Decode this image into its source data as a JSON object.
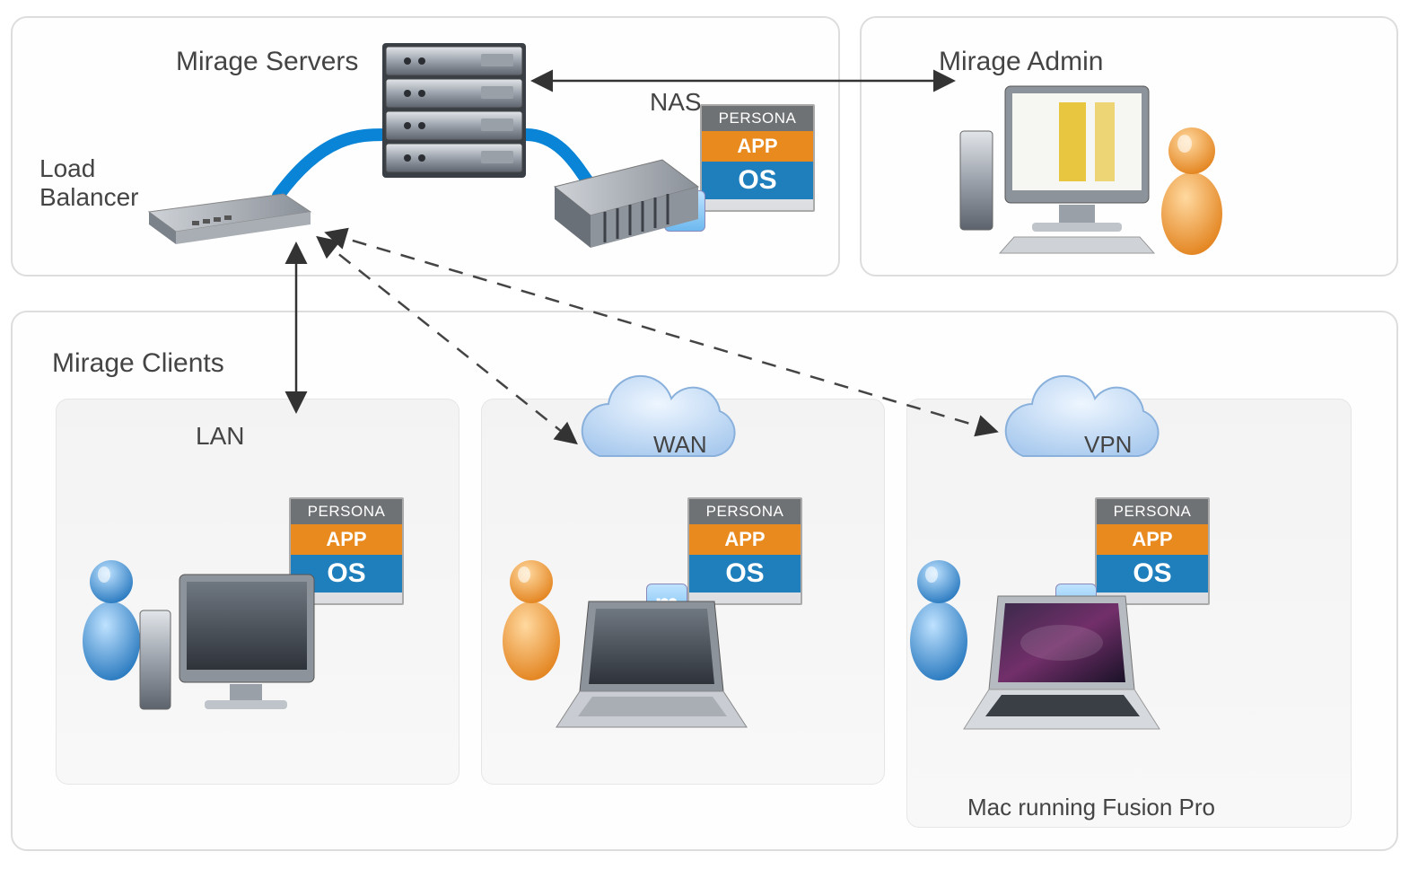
{
  "labels": {
    "servers_title": "Mirage Servers",
    "admin_title": "Mirage Admin",
    "load_balancer_l1": "Load",
    "load_balancer_l2": "Balancer",
    "nas": "NAS",
    "clients_title": "Mirage Clients",
    "lan": "LAN",
    "wan": "WAN",
    "vpn": "VPN",
    "mac_caption": "Mac running Fusion Pro"
  },
  "stack": {
    "persona": "PERSONA",
    "app": "APP",
    "os": "OS"
  },
  "mirage_tag": "m",
  "colors": {
    "persona_bg": "#6f7274",
    "app_bg": "#e98a1f",
    "os_bg": "#1f7fbd",
    "cable_blue": "#0a84d6",
    "cloud_fill": "#bcd7f1",
    "cloud_stroke": "#7aa9d6"
  },
  "clients": [
    {
      "key": "lan",
      "device": "desktop",
      "user_color": "blue"
    },
    {
      "key": "wan",
      "device": "laptop",
      "user_color": "orange"
    },
    {
      "key": "vpn",
      "device": "macbook",
      "user_color": "blue",
      "caption_key": "mac_caption"
    }
  ]
}
